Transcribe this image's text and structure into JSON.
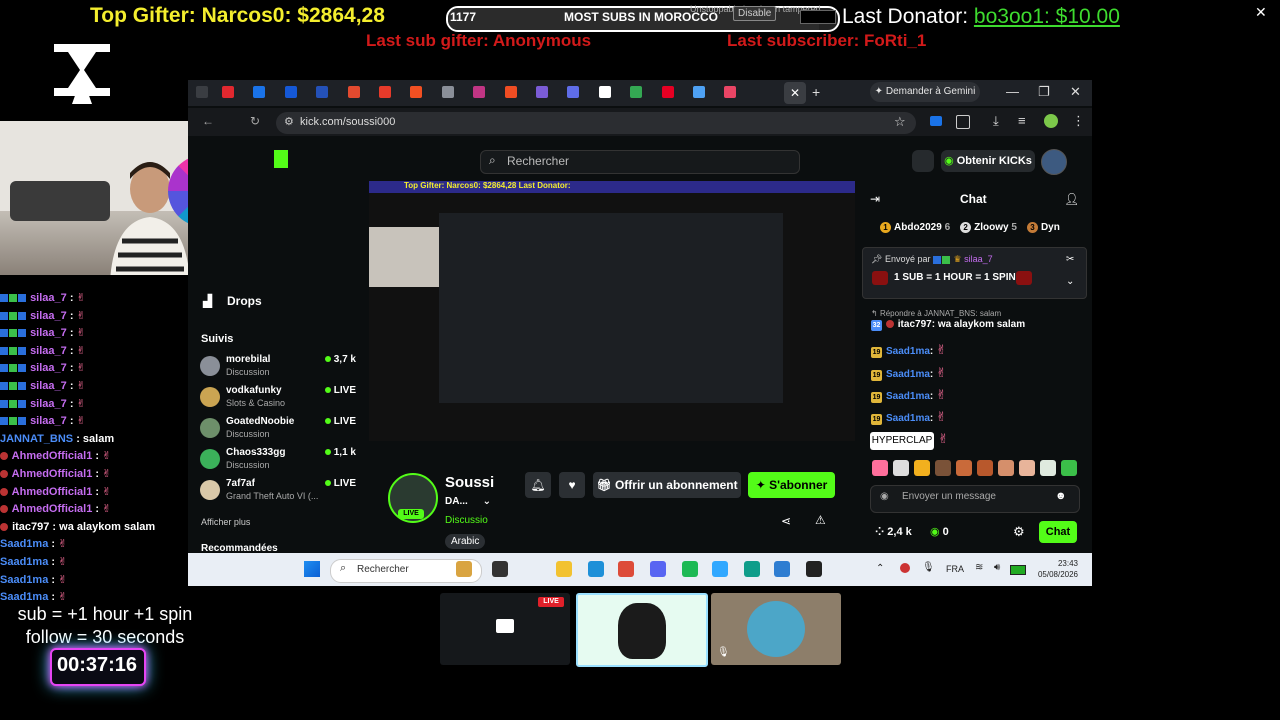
{
  "overlay": {
    "top_gifter": "Top Gifter: Narcos0: $2864,28",
    "goal_count": "1177",
    "goal_title": "MOST SUBS IN MOROCCO",
    "goal_progress_fraction": 0.95,
    "goal_note": "Unstoppable has been tampered",
    "disable_label": "Disable",
    "last_donator_label": "Last Donator:",
    "last_donator_value": "bo3oo1: $10.00",
    "last_sub_gifter": "Last sub gifter: Anonymous",
    "last_subscriber": "Last subscriber: FoRti_1",
    "subrule_line1": "sub  = +1 hour +1 spin",
    "subrule_line2": "follow = 30 seconds",
    "timer": "00:37:16",
    "left_chat": [
      {
        "user": "silaa_7",
        "sep": " : ",
        "text": "",
        "color": "purple",
        "badges": 3
      },
      {
        "user": "silaa_7",
        "sep": " : ",
        "text": "",
        "color": "purple",
        "badges": 3
      },
      {
        "user": "silaa_7",
        "sep": " : ",
        "text": "",
        "color": "purple",
        "badges": 3
      },
      {
        "user": "silaa_7",
        "sep": " : ",
        "text": "",
        "color": "purple",
        "badges": 3
      },
      {
        "user": "silaa_7",
        "sep": " : ",
        "text": "",
        "color": "purple",
        "badges": 3
      },
      {
        "user": "silaa_7",
        "sep": " : ",
        "text": "",
        "color": "purple",
        "badges": 3
      },
      {
        "user": "silaa_7",
        "sep": " : ",
        "text": "",
        "color": "purple",
        "badges": 3
      },
      {
        "user": "silaa_7",
        "sep": " : ",
        "text": "",
        "color": "purple",
        "badges": 3
      },
      {
        "user": "JANNAT_BNS",
        "sep": " : ",
        "text": "salam",
        "color": "blue",
        "badges": 0
      },
      {
        "user": "AhmedOfficial1",
        "sep": " : ",
        "text": "",
        "color": "purple",
        "badges": 1
      },
      {
        "user": "AhmedOfficial1",
        "sep": " : ",
        "text": "",
        "color": "purple",
        "badges": 1
      },
      {
        "user": "AhmedOfficial1",
        "sep": " : ",
        "text": "",
        "color": "purple",
        "badges": 1
      },
      {
        "user": "AhmedOfficial1",
        "sep": " : ",
        "text": "",
        "color": "purple",
        "badges": 1
      },
      {
        "user": "itac797",
        "sep": " : ",
        "text": "wa alaykom salam",
        "color": "white",
        "badges": 1
      },
      {
        "user": "Saad1ma",
        "sep": " : ",
        "text": "",
        "color": "blue",
        "badges": 0
      },
      {
        "user": "Saad1ma",
        "sep": " : ",
        "text": "",
        "color": "blue",
        "badges": 0
      },
      {
        "user": "Saad1ma",
        "sep": " : ",
        "text": "",
        "color": "blue",
        "badges": 0
      },
      {
        "user": "Saad1ma",
        "sep": " : ",
        "text": "",
        "color": "blue",
        "badges": 0
      }
    ]
  },
  "browser": {
    "gemini_label": "Demander à Gemini",
    "url": "kick.com/soussi000",
    "tab_icon_colors": [
      "#e1282f",
      "#1a73e8",
      "#1558d6",
      "#2451b8",
      "#e34a2f",
      "#e63a2a",
      "#f25022",
      "#8a8f98",
      "#c13584",
      "#f04d23",
      "#7b5cd6",
      "#5f6de8",
      "#ffffff",
      "#34a853",
      "#e60023",
      "#4ea1f3",
      "#e94565"
    ]
  },
  "kick": {
    "search_placeholder": "Rechercher",
    "obtain_kicks": "Obtenir KICKs",
    "drops": "Drops",
    "following_title": "Suivis",
    "following": [
      {
        "name": "morebilal",
        "category": "Discussion",
        "status": "3,7 k",
        "live_dot": true
      },
      {
        "name": "vodkafunky",
        "category": "Slots & Casino",
        "status": "LIVE",
        "live_dot": true
      },
      {
        "name": "GoatedNoobie",
        "category": "Discussion",
        "status": "LIVE",
        "live_dot": true
      },
      {
        "name": "Chaos333gg",
        "category": "Discussion",
        "status": "1,1 k",
        "live_dot": true
      },
      {
        "name": "7af7af",
        "category": "Grand Theft Auto VI (...",
        "status": "LIVE",
        "live_dot": true
      }
    ],
    "show_more": "Afficher plus",
    "recommended": "Recommandées",
    "player_banner": "Top Gifter: Narcos0: $2864,28                                      Last Donator:",
    "streamer_name": "Soussi",
    "stream_title": "DA...",
    "category": "Discussio",
    "language": "Arabic",
    "live_label": "LIVE",
    "gift_sub": "Offrir un abonnement",
    "subscribe": "S'abonner",
    "chat": {
      "title": "Chat",
      "top_gifters": [
        {
          "rank": "1",
          "name": "Abdo2029",
          "count": "6"
        },
        {
          "rank": "2",
          "name": "Zloowy",
          "count": "5"
        },
        {
          "rank": "3",
          "name": "Dyn",
          "count": ""
        }
      ],
      "pinned_by_label": "Envoyé par",
      "pinned_by_user": "silaa_7",
      "pinned_message": "1 SUB = 1 HOUR = 1 SPIN",
      "reply_to": "Répondre à JANNAT_BNS: salam",
      "messages": [
        {
          "level": "32",
          "user": "itac797",
          "text": "wa alaykom salam",
          "color": "white"
        },
        {
          "level": "19",
          "user": "Saad1ma",
          "text": "",
          "color": "blue"
        },
        {
          "level": "19",
          "user": "Saad1ma",
          "text": "",
          "color": "blue"
        },
        {
          "level": "19",
          "user": "Saad1ma",
          "text": "",
          "color": "blue"
        },
        {
          "level": "19",
          "user": "Saad1ma",
          "text": "",
          "color": "blue"
        }
      ],
      "tooltip": "HYPERCLAP",
      "input_placeholder": "Envoyer un message",
      "viewers": "2,4 k",
      "kicks": "0",
      "chat_button": "Chat"
    }
  },
  "taskbar": {
    "search": "Rechercher",
    "language": "FRA",
    "time": "23:43",
    "date": "05/08/2026"
  },
  "thumbnails": {
    "live_label": "LIVE"
  },
  "colors": {
    "kick_green": "#53fc18",
    "gifter_yellow": "#f4ee2e",
    "alert_red": "#d21a1a",
    "donator_green": "#3edb2f"
  }
}
